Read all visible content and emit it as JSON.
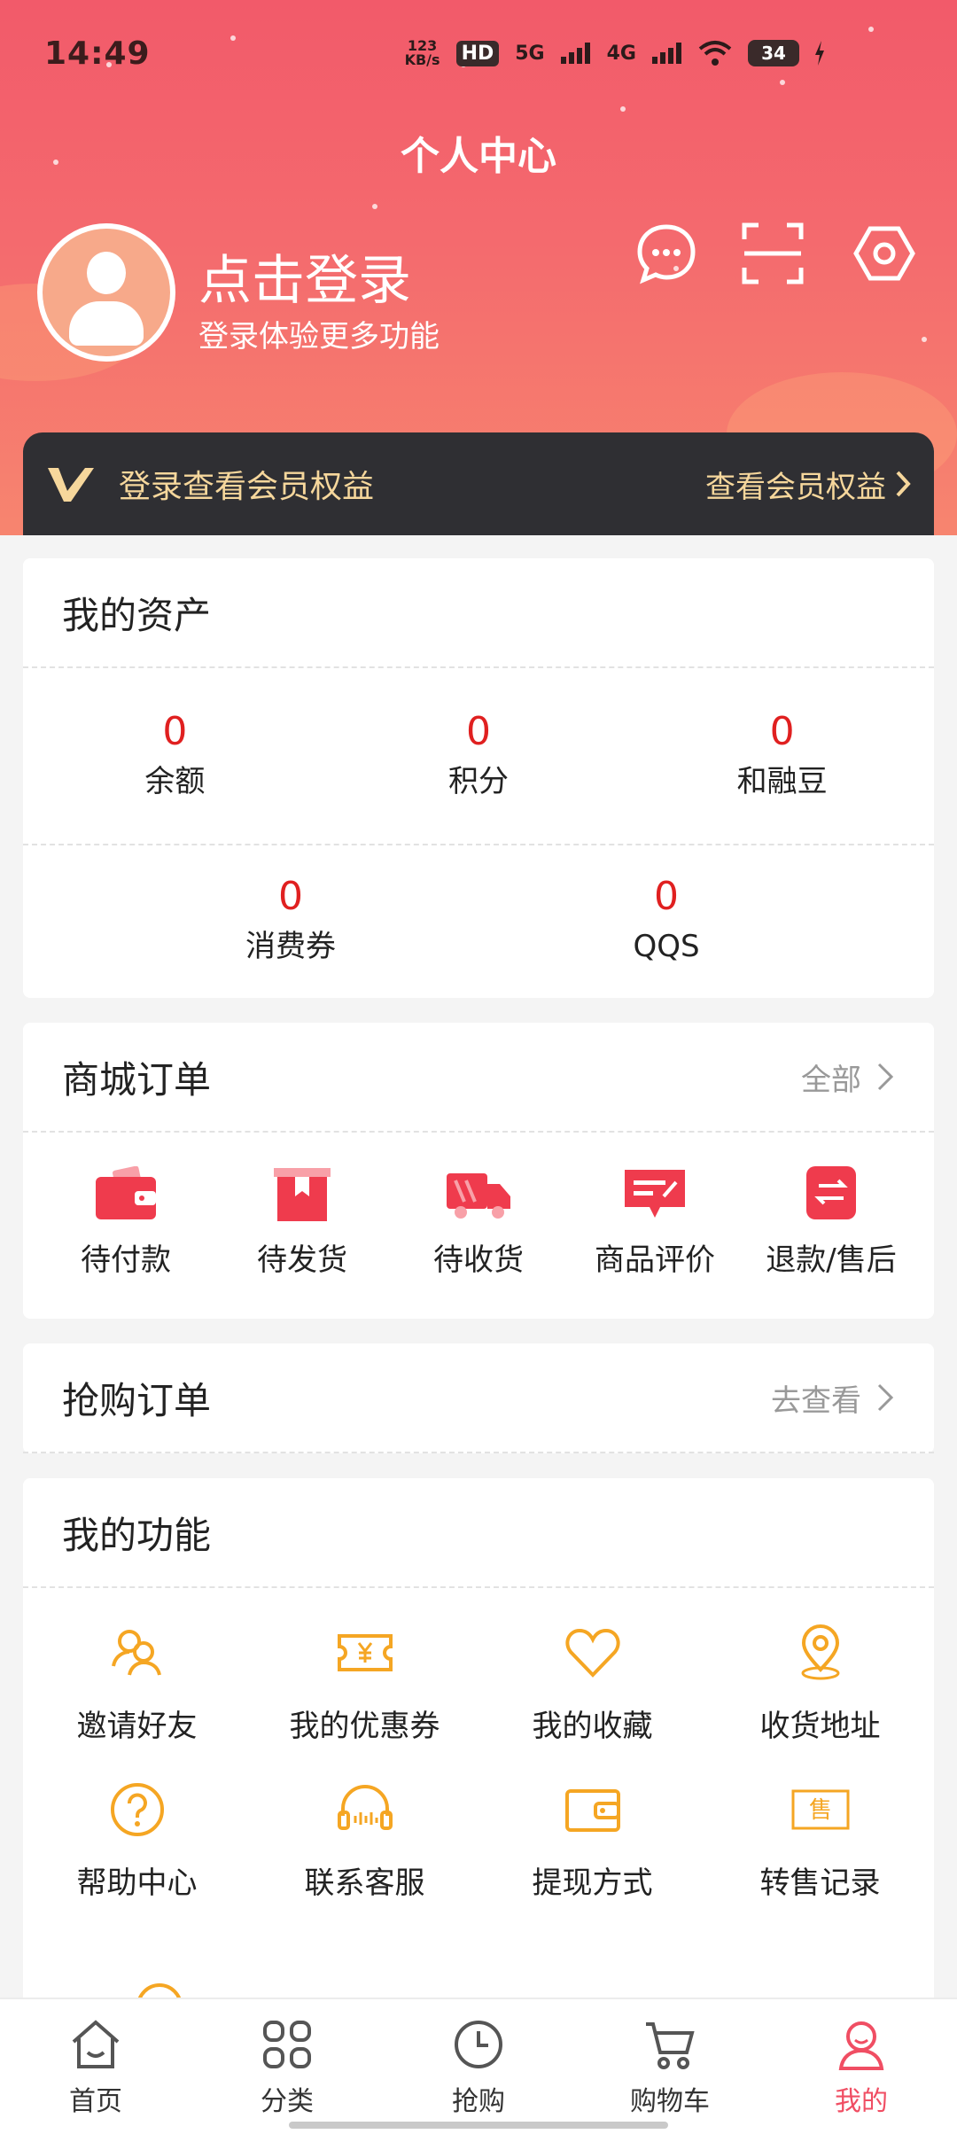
{
  "status_bar": {
    "time": "14:49",
    "speed": "123 KB/s",
    "hd": "HD",
    "net_5g": "5G",
    "net_4g": "4G",
    "battery": "34"
  },
  "header": {
    "title": "个人中心",
    "login_title": "点击登录",
    "login_subtitle": "登录体验更多功能",
    "icons": [
      "message-icon",
      "scan-icon",
      "settings-icon"
    ]
  },
  "member_bar": {
    "label": "登录查看会员权益",
    "link": "查看会员权益"
  },
  "assets": {
    "title": "我的资产",
    "items": [
      {
        "value": "0",
        "label": "余额"
      },
      {
        "value": "0",
        "label": "积分"
      },
      {
        "value": "0",
        "label": "和融豆"
      },
      {
        "value": "0",
        "label": "消费券"
      },
      {
        "value": "0",
        "label": "QQS"
      }
    ]
  },
  "mall_orders": {
    "title": "商城订单",
    "more": "全部",
    "items": [
      {
        "label": "待付款",
        "icon": "wallet-icon"
      },
      {
        "label": "待发货",
        "icon": "package-icon"
      },
      {
        "label": "待收货",
        "icon": "truck-icon"
      },
      {
        "label": "商品评价",
        "icon": "review-icon"
      },
      {
        "label": "退款/售后",
        "icon": "refund-icon"
      }
    ]
  },
  "flash_orders": {
    "title": "抢购订单",
    "more": "去查看"
  },
  "functions": {
    "title": "我的功能",
    "items": [
      {
        "label": "邀请好友",
        "icon": "invite-friends-icon"
      },
      {
        "label": "我的优惠券",
        "icon": "coupon-icon"
      },
      {
        "label": "我的收藏",
        "icon": "heart-icon"
      },
      {
        "label": "收货地址",
        "icon": "location-icon"
      },
      {
        "label": "帮助中心",
        "icon": "help-icon"
      },
      {
        "label": "联系客服",
        "icon": "headset-icon"
      },
      {
        "label": "提现方式",
        "icon": "withdraw-wallet-icon"
      },
      {
        "label": "转售记录",
        "icon": "resale-icon"
      }
    ],
    "resale_badge": "售"
  },
  "bottom_nav": {
    "items": [
      {
        "label": "首页",
        "icon": "home-icon"
      },
      {
        "label": "分类",
        "icon": "category-icon"
      },
      {
        "label": "抢购",
        "icon": "clock-icon"
      },
      {
        "label": "购物车",
        "icon": "cart-icon"
      },
      {
        "label": "我的",
        "icon": "profile-icon",
        "active": true
      }
    ]
  },
  "colors": {
    "accent": "#f04e63",
    "asset_number": "#e02020",
    "function_icon": "#f5a623",
    "member_gold": "#f6d79c"
  }
}
